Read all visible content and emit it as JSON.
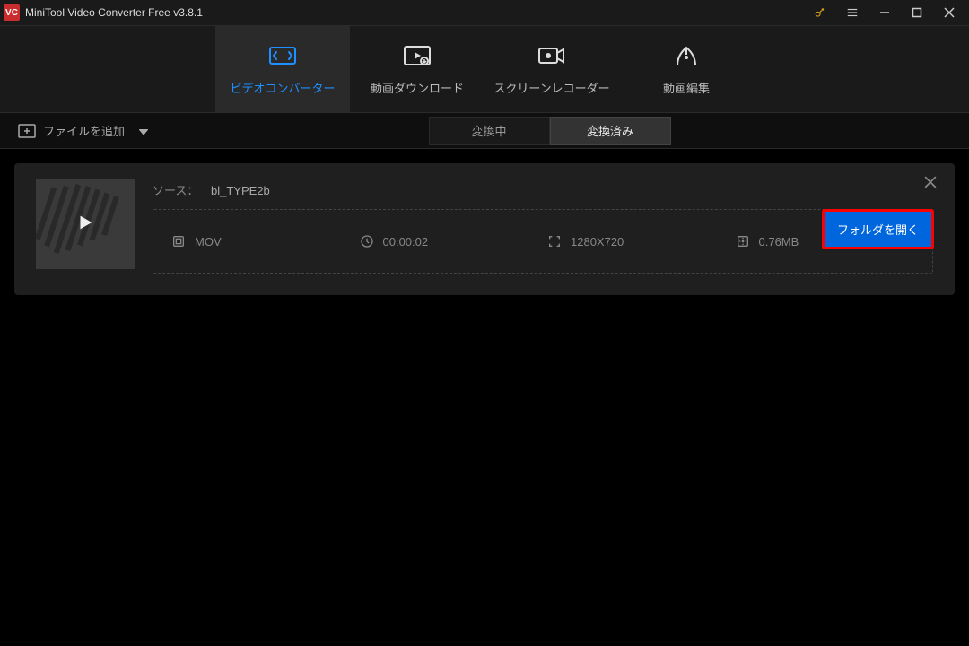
{
  "app": {
    "title": "MiniTool Video Converter Free v3.8.1"
  },
  "nav": {
    "items": [
      {
        "label": "ビデオコンバーター",
        "name": "nav-converter",
        "active": true
      },
      {
        "label": "動画ダウンロード",
        "name": "nav-download",
        "active": false
      },
      {
        "label": "スクリーンレコーダー",
        "name": "nav-recorder",
        "active": false
      },
      {
        "label": "動画編集",
        "name": "nav-editor",
        "active": false
      }
    ]
  },
  "toolbar": {
    "add_file": "ファイルを追加",
    "tabs": [
      {
        "label": "変換中",
        "name": "tab-converting",
        "active": false
      },
      {
        "label": "変換済み",
        "name": "tab-converted",
        "active": true
      }
    ]
  },
  "file": {
    "source_label": "ソース：",
    "source_name": "bl_TYPE2b",
    "format": "MOV",
    "duration": "00:00:02",
    "resolution": "1280X720",
    "size": "0.76MB",
    "open_folder": "フォルダを開く"
  }
}
